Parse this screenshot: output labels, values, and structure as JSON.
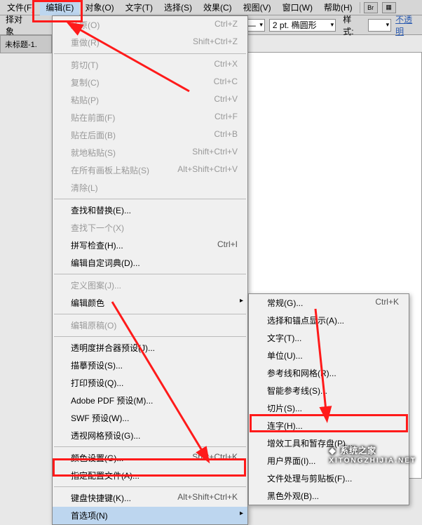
{
  "menubar": {
    "items": [
      {
        "label": "文件(F)"
      },
      {
        "label": "编辑(E)",
        "active": true
      },
      {
        "label": "对象(O)"
      },
      {
        "label": "文字(T)"
      },
      {
        "label": "选择(S)"
      },
      {
        "label": "效果(C)"
      },
      {
        "label": "视图(V)"
      },
      {
        "label": "窗口(W)"
      },
      {
        "label": "帮助(H)"
      }
    ],
    "br_icon": "Br"
  },
  "toolbar": {
    "left_label": "择对象",
    "stroke_icon": "—",
    "stroke_value": "2 pt. 椭圆形",
    "style_label": "样式:",
    "opacity_link": "不透明"
  },
  "doc_tab": "未标题-1.",
  "main_menu": [
    {
      "label": "还原(O)",
      "shortcut": "Ctrl+Z",
      "disabled": true
    },
    {
      "label": "重做(R)",
      "shortcut": "Shift+Ctrl+Z",
      "disabled": true
    },
    {
      "sep": true
    },
    {
      "label": "剪切(T)",
      "shortcut": "Ctrl+X",
      "disabled": true
    },
    {
      "label": "复制(C)",
      "shortcut": "Ctrl+C",
      "disabled": true
    },
    {
      "label": "粘贴(P)",
      "shortcut": "Ctrl+V",
      "disabled": true
    },
    {
      "label": "贴在前面(F)",
      "shortcut": "Ctrl+F",
      "disabled": true
    },
    {
      "label": "贴在后面(B)",
      "shortcut": "Ctrl+B",
      "disabled": true
    },
    {
      "label": "就地粘贴(S)",
      "shortcut": "Shift+Ctrl+V",
      "disabled": true
    },
    {
      "label": "在所有画板上粘贴(S)",
      "shortcut": "Alt+Shift+Ctrl+V",
      "disabled": true
    },
    {
      "label": "清除(L)",
      "disabled": true
    },
    {
      "sep": true
    },
    {
      "label": "查找和替换(E)..."
    },
    {
      "label": "查找下一个(X)",
      "disabled": true
    },
    {
      "label": "拼写检查(H)...",
      "shortcut": "Ctrl+I"
    },
    {
      "label": "编辑自定词典(D)..."
    },
    {
      "sep": true
    },
    {
      "label": "定义图案(J)...",
      "disabled": true
    },
    {
      "label": "编辑颜色",
      "sub": true
    },
    {
      "sep": true
    },
    {
      "label": "编辑原稿(O)",
      "disabled": true
    },
    {
      "sep": true
    },
    {
      "label": "透明度拼合器预设(J)..."
    },
    {
      "label": "描摹预设(S)..."
    },
    {
      "label": "打印预设(Q)..."
    },
    {
      "label": "Adobe PDF 预设(M)..."
    },
    {
      "label": "SWF 预设(W)..."
    },
    {
      "label": "透视网格预设(G)..."
    },
    {
      "sep": true
    },
    {
      "label": "颜色设置(G)...",
      "shortcut": "Shift+Ctrl+K"
    },
    {
      "label": "指定配置文件(A)..."
    },
    {
      "sep": true
    },
    {
      "label": "键盘快捷键(K)...",
      "shortcut": "Alt+Shift+Ctrl+K"
    },
    {
      "label": "首选项(N)",
      "sub": true,
      "highlight": true
    }
  ],
  "sub_menu": [
    {
      "label": "常规(G)...",
      "shortcut": "Ctrl+K"
    },
    {
      "label": "选择和锚点显示(A)..."
    },
    {
      "label": "文字(T)..."
    },
    {
      "label": "单位(U)..."
    },
    {
      "label": "参考线和网格(R)..."
    },
    {
      "label": "智能参考线(S)..."
    },
    {
      "label": "切片(S)..."
    },
    {
      "label": "连字(H)..."
    },
    {
      "label": "增效工具和暂存盘(P)..."
    },
    {
      "label": "用户界面(I)..."
    },
    {
      "label": "文件处理与剪贴板(F)..."
    },
    {
      "label": "黑色外观(B)..."
    }
  ],
  "watermark": {
    "main": "系统之家",
    "sub": "XITONGZHIJIA.NET"
  }
}
